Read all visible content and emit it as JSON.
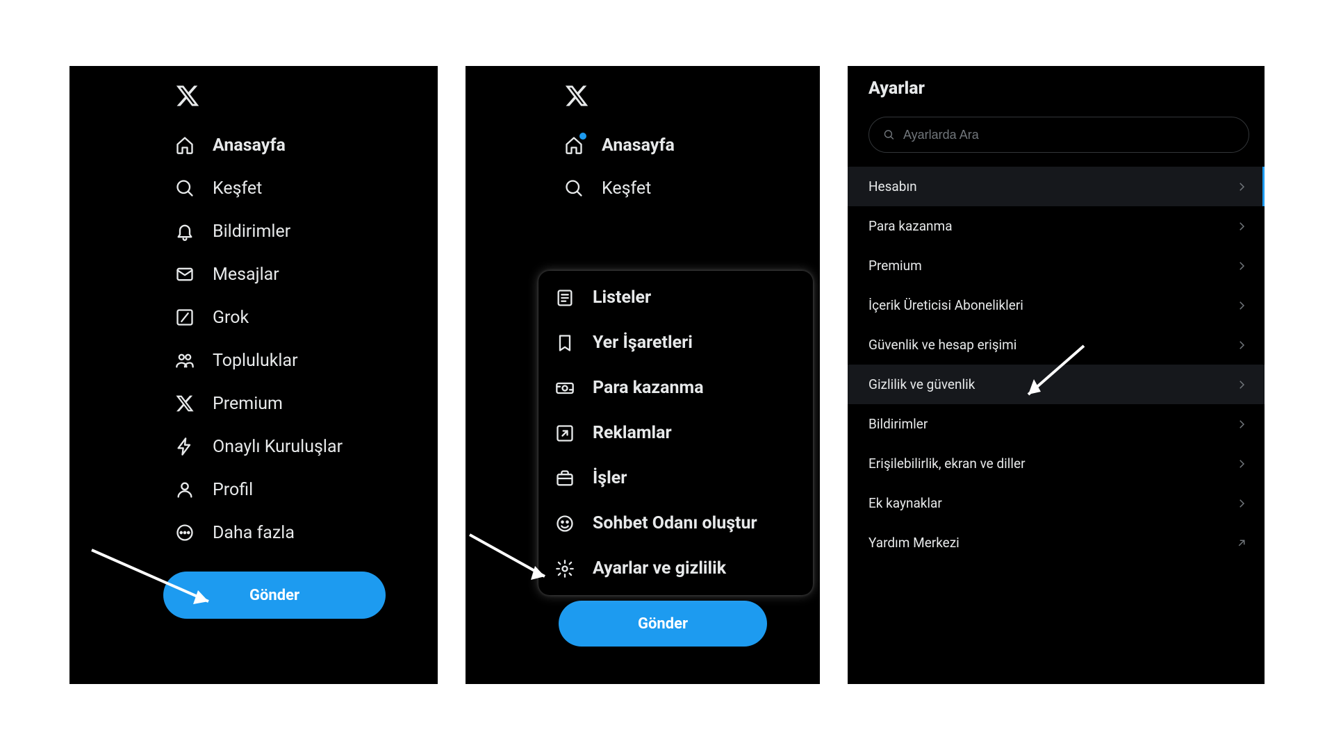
{
  "panel1": {
    "nav": [
      {
        "icon": "home",
        "label": "Anasayfa",
        "active": true
      },
      {
        "icon": "search",
        "label": "Keşfet"
      },
      {
        "icon": "bell",
        "label": "Bildirimler"
      },
      {
        "icon": "mail",
        "label": "Mesajlar"
      },
      {
        "icon": "grok",
        "label": "Grok"
      },
      {
        "icon": "communities",
        "label": "Topluluklar"
      },
      {
        "icon": "x",
        "label": "Premium"
      },
      {
        "icon": "lightning",
        "label": "Onaylı Kuruluşlar"
      },
      {
        "icon": "profile",
        "label": "Profil"
      },
      {
        "icon": "more",
        "label": "Daha fazla"
      }
    ],
    "post": "Gönder"
  },
  "panel2": {
    "nav": [
      {
        "icon": "home",
        "label": "Anasayfa",
        "active": true,
        "dot": true
      },
      {
        "icon": "search",
        "label": "Keşfet"
      }
    ],
    "popup": [
      {
        "icon": "list",
        "label": "Listeler"
      },
      {
        "icon": "bookmark",
        "label": "Yer İşaretleri"
      },
      {
        "icon": "money",
        "label": "Para kazanma"
      },
      {
        "icon": "ad",
        "label": "Reklamlar"
      },
      {
        "icon": "briefcase",
        "label": "İşler"
      },
      {
        "icon": "smile",
        "label": "Sohbet Odanı oluştur"
      },
      {
        "icon": "gear",
        "label": "Ayarlar ve gizlilik"
      }
    ],
    "post": "Gönder"
  },
  "panel3": {
    "title": "Ayarlar",
    "search_placeholder": "Ayarlarda Ara",
    "items": [
      {
        "label": "Hesabın",
        "selected": true,
        "accent": true,
        "right": "chevron"
      },
      {
        "label": "Para kazanma",
        "right": "chevron"
      },
      {
        "label": "Premium",
        "right": "chevron"
      },
      {
        "label": "İçerik Üreticisi Abonelikleri",
        "right": "chevron"
      },
      {
        "label": "Güvenlik ve hesap erişimi",
        "right": "chevron"
      },
      {
        "label": "Gizlilik ve güvenlik",
        "highlighted": true,
        "right": "chevron"
      },
      {
        "label": "Bildirimler",
        "right": "chevron"
      },
      {
        "label": "Erişilebilirlik, ekran ve diller",
        "right": "chevron"
      },
      {
        "label": "Ek kaynaklar",
        "right": "chevron"
      },
      {
        "label": "Yardım Merkezi",
        "right": "external"
      }
    ]
  }
}
